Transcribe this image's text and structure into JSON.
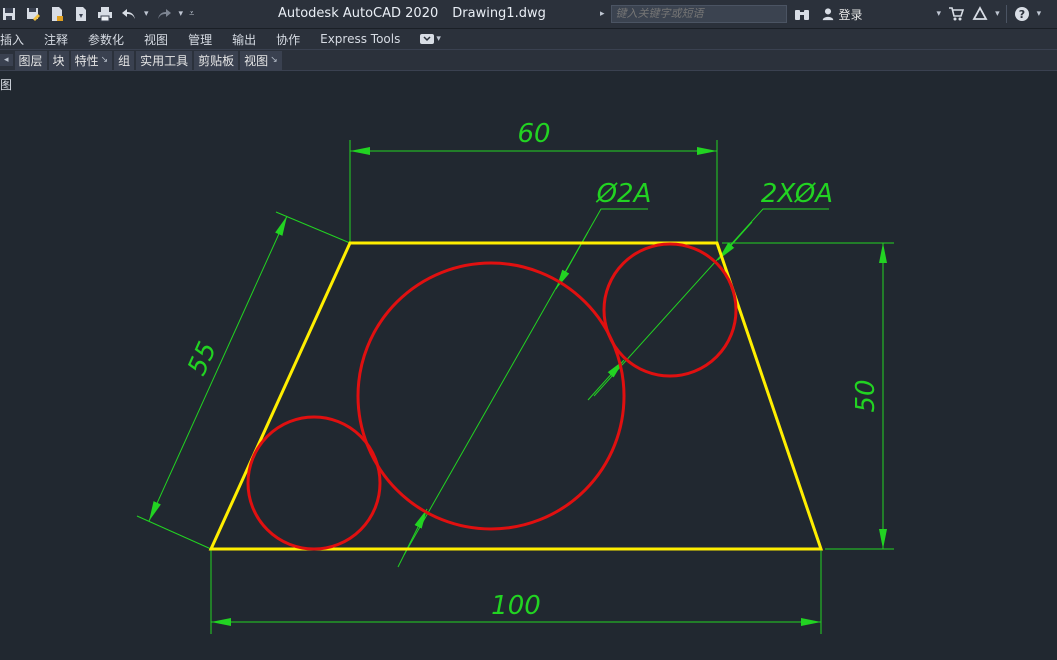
{
  "app": {
    "title": "Autodesk AutoCAD 2020",
    "document": "Drawing1.dwg"
  },
  "search": {
    "placeholder": "键入关键字或短语"
  },
  "account": {
    "login_label": "登录"
  },
  "ribbon_tabs": [
    "插入",
    "注释",
    "参数化",
    "视图",
    "管理",
    "输出",
    "协作",
    "Express Tools"
  ],
  "panels": [
    "图层",
    "块",
    "特性",
    "组",
    "实用工具",
    "剪贴板",
    "视图"
  ],
  "view_tab_label": "图",
  "drawing": {
    "dimensions": {
      "top": "60",
      "bottom": "100",
      "left": "55",
      "right": "50",
      "large_circle": "Ø2A",
      "small_circles": "2XØA"
    },
    "colors": {
      "outline": "#ffee00",
      "circles": "#e01010",
      "dims": "#22d322",
      "background": "#212830"
    }
  }
}
